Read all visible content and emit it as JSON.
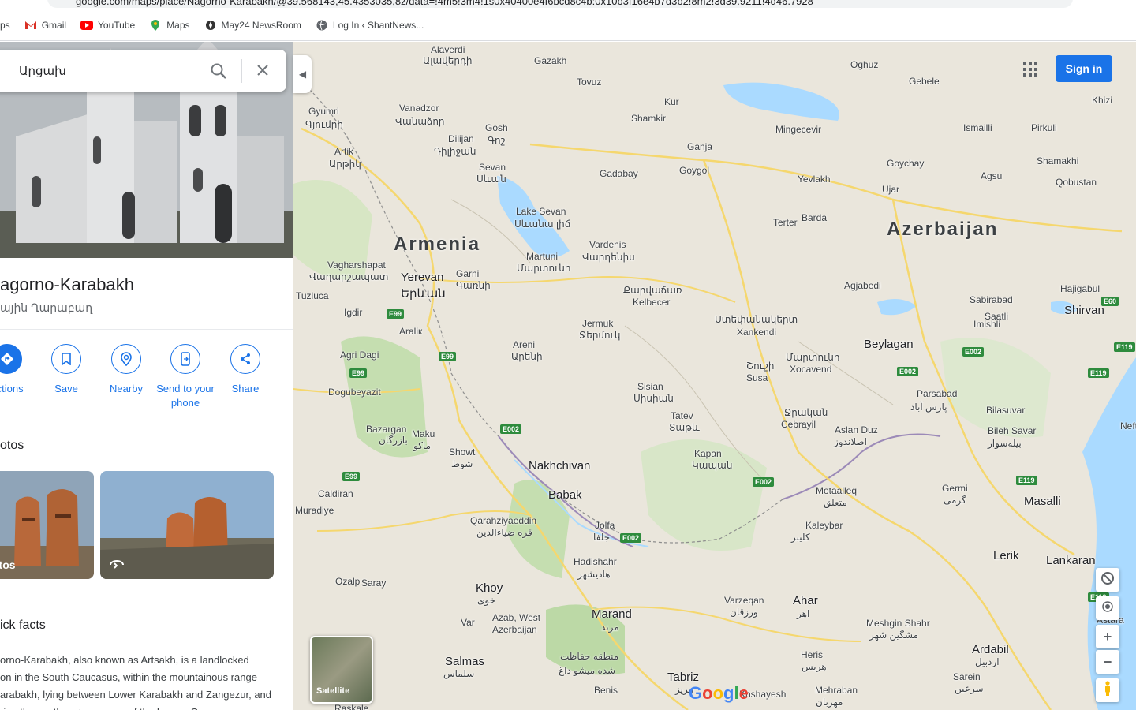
{
  "browser": {
    "url": "google.com/maps/place/Nagorno-Karabakh/@39.568143,45.4353035,8z/data=!4m5!3m4!1s0x40400e4f6bcd8c4b:0x10b3f16e4b7d3b2!8m2!3d39.9211!4d46.7928",
    "bookmarks": [
      "ps",
      "Gmail",
      "YouTube",
      "Maps",
      "May24 NewsRoom",
      "Log In ‹ ShantNews..."
    ]
  },
  "search": {
    "query": "Արցախ"
  },
  "place": {
    "title": "agorno-Karabakh",
    "subtitle": "ային Ղարաբաղ",
    "actions": [
      "ections",
      "Save",
      "Nearby",
      "Send to your phone",
      "Share"
    ],
    "photos_title": "otos",
    "photo_caption": "otos",
    "facts_title": "ick facts",
    "facts_lines": [
      "orno-Karabakh, also known as Artsakh, is a landlocked",
      "on in the South Caucasus, within the mountainous range",
      "arabakh, lying between Lower Karabakh and Zangezur, and",
      "ring the southeastern range of the Lesser Caucasus"
    ]
  },
  "map": {
    "signin": "Sign in",
    "satellite": "Satellite",
    "countries": [
      "Armenia",
      "Azerbaijan"
    ],
    "cities": [
      "Alaverdi",
      "Ալավերդի",
      "Gazakh",
      "Tovuz",
      "Oghuz",
      "Gebele",
      "Khizi",
      "Gyumri",
      "Գյումրի",
      "Vanadzor",
      "Վանաձոր",
      "Kur",
      "Shamkir",
      "Mingecevir",
      "Ismailli",
      "Pirkuli",
      "Gosh",
      "Գոշ",
      "Dilijan",
      "Դիլիջան",
      "Ganja",
      "Goygol",
      "Goychay",
      "Shamakhi",
      "Artik",
      "Արթիկ",
      "Sevan",
      "Սևան",
      "Gadabay",
      "Yevlakh",
      "Ujar",
      "Agsu",
      "Qobustan",
      "Lake Sevan",
      "Սևանա լիճ",
      "Terter",
      "Barda",
      "Martuni",
      "Մարտունի",
      "Vardenis",
      "Վարդենիս",
      "Vagharshapat",
      "Վաղարշապատ",
      "Yerevan",
      "Երևան",
      "Garni",
      "Գառնի",
      "Tuzluca",
      "Քարվաճառ",
      "Kelbecer",
      "Agjabedi",
      "Sabirabad",
      "Hajigabul",
      "Shirvan",
      "Igdir",
      "Araliк",
      "Jermuk",
      "Ջերմուկ",
      "Ստեփանակերտ",
      "Xankendi",
      "Imishli",
      "Saatli",
      "Beylagan",
      "Areni",
      "Արենի",
      "Շուշի",
      "Susa",
      "Մարտունի",
      "Xocavend",
      "Agri Dagi",
      "Dogubeyazit",
      "Sisian",
      "Սիսիան",
      "Parsabad",
      "پارس آباد",
      "Bilasuvar",
      "Tatev",
      "Տաթև",
      "Ջրական",
      "Cebrayil",
      "Aslan Duz",
      "اصلاندوز",
      "Bileh Savar",
      "بیله‌سوار",
      "Neftcha",
      "Bazargan",
      "بازرگان",
      "Maku",
      "ماکو",
      "Showt",
      "شوط",
      "Nakhchivan",
      "Kapan",
      "Կապան",
      "Caldiran",
      "Babak",
      "Motaalleq",
      "متعلق",
      "Germi",
      "گرمی",
      "Masalli",
      "Muradiye",
      "Qarahziyaeddin",
      "قره ضیاءالدین",
      "Jolfa",
      "جلفا",
      "Kaleybar",
      "کلیبر",
      "Hadishahr",
      "هادیشهر",
      "Lerik",
      "Lankaran",
      "Ozalp",
      "Saray",
      "Khoy",
      "خوی",
      "Varzeqan",
      "ورزقان",
      "Ahar",
      "اهر",
      "Astara",
      "Azab, West",
      "Azerbaijan",
      "Var",
      "Marand",
      "مرند",
      "Meshgin Shahr",
      "مشگین شهر",
      "Heris",
      "هریس",
      "Ardabil",
      "اردبیل",
      "Salmas",
      "سلماس",
      "منطقه حفاظت",
      "شده میشو داغ",
      "Tabriz",
      "تبریز",
      "Benis",
      "Sarein",
      "سرعین",
      "Mehraban",
      "مهربان",
      "Khshayesh",
      "Raskale"
    ]
  },
  "colors": {
    "accent": "#1a73e8",
    "land": "#eae6dc",
    "water": "#aadaff",
    "green": "#c8e6b2"
  }
}
